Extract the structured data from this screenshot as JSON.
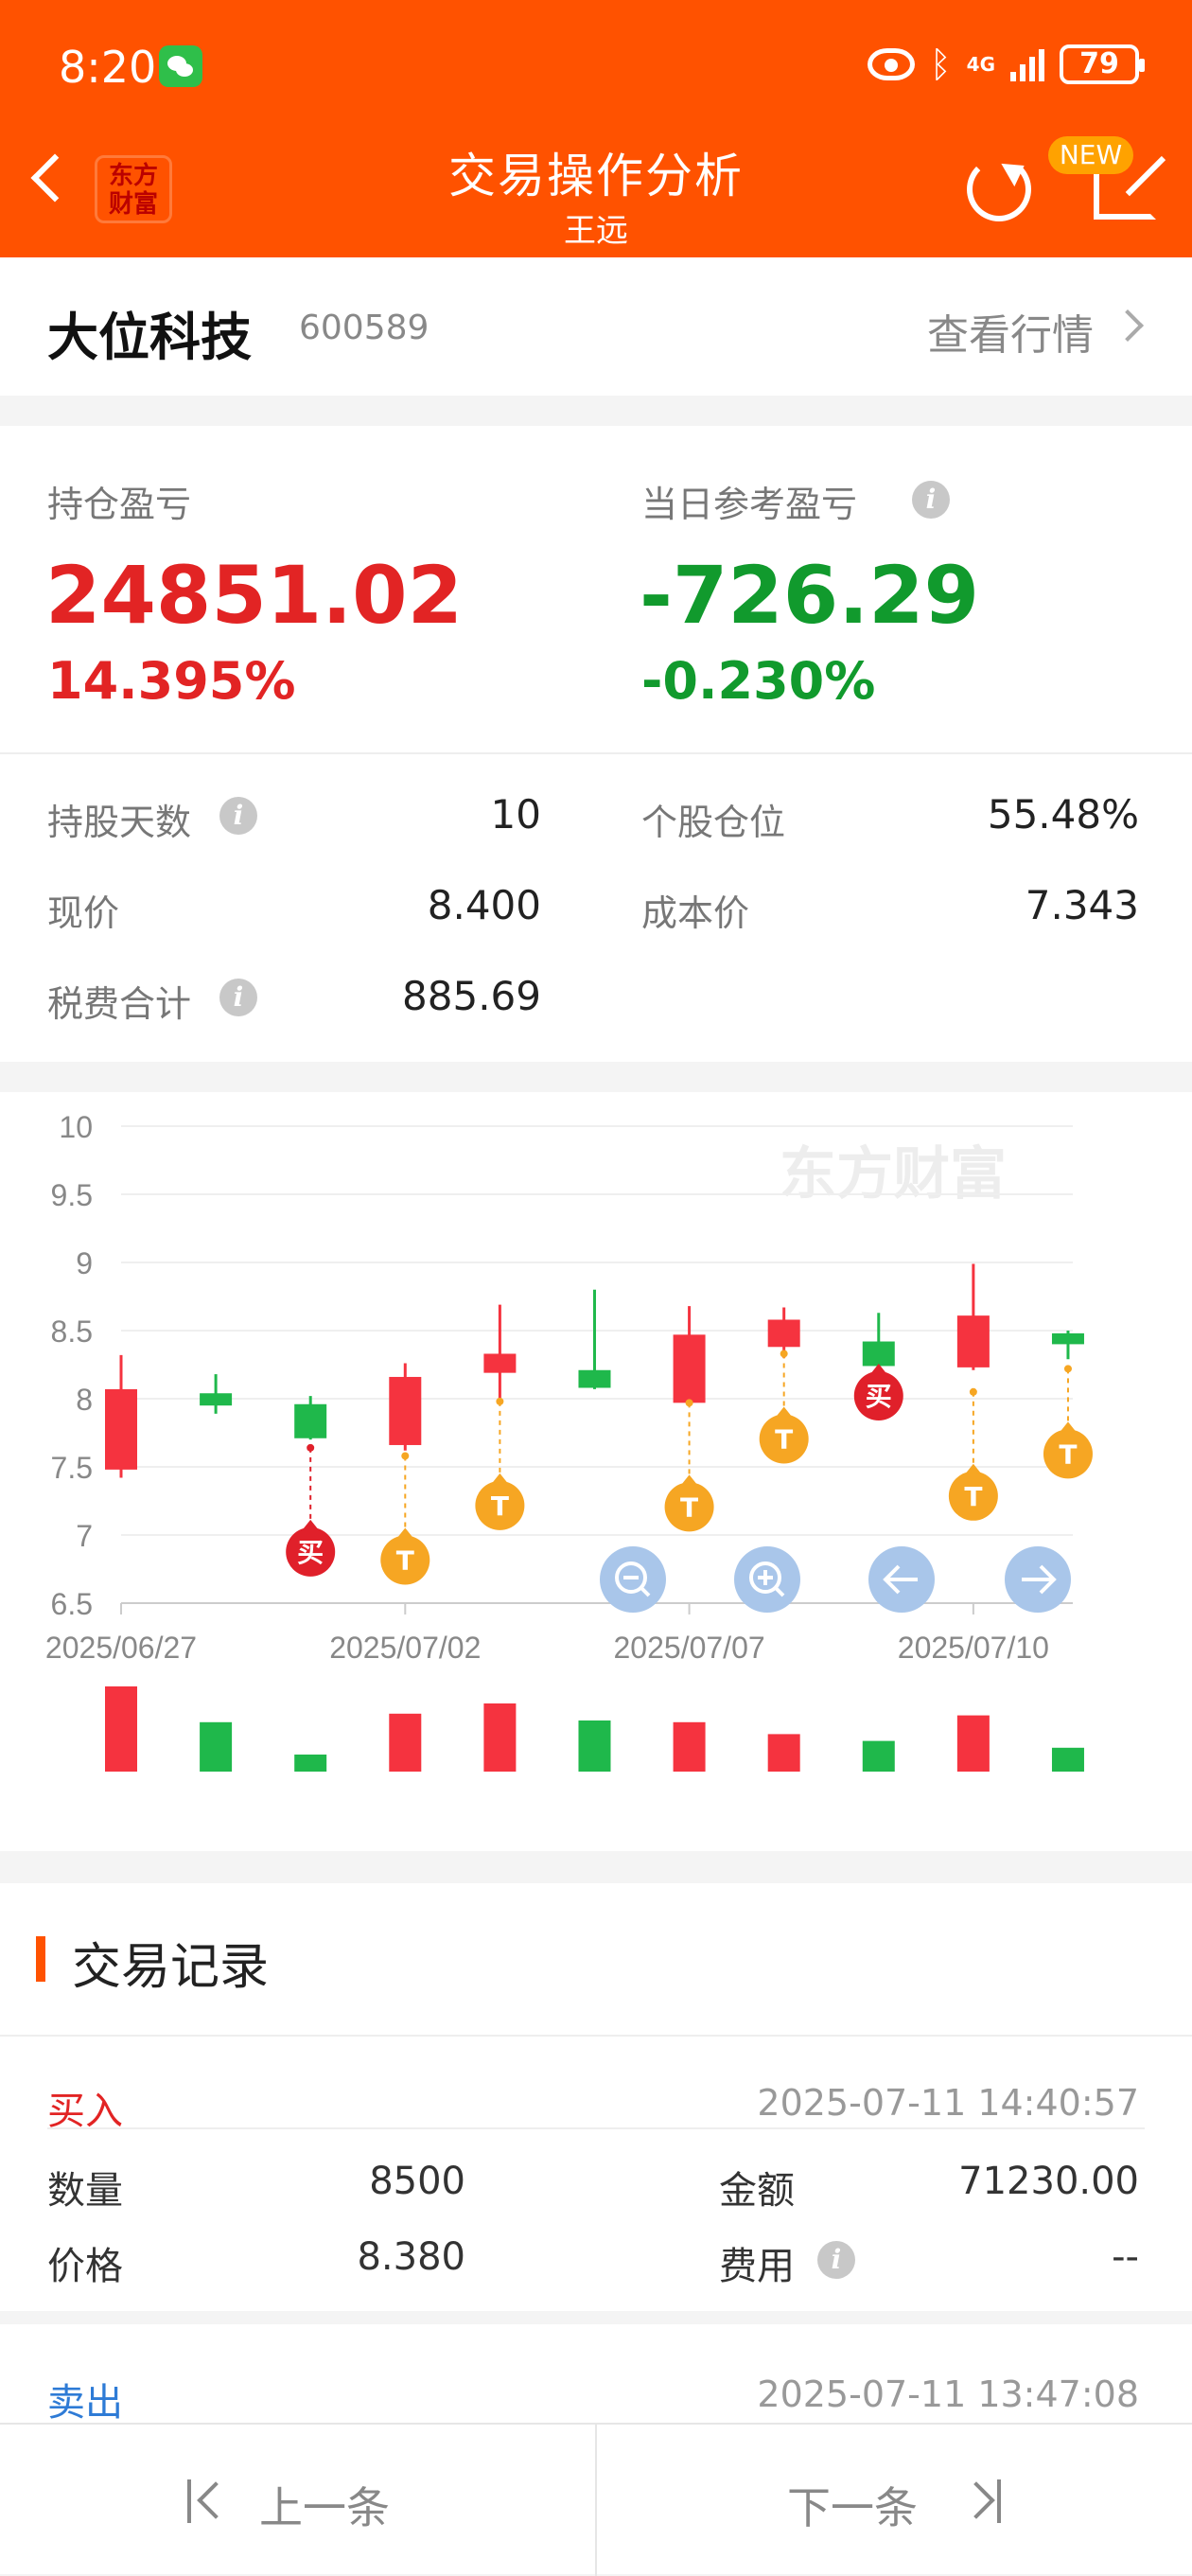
{
  "status": {
    "time": "8:20",
    "network": "4G",
    "battery": "79"
  },
  "header": {
    "title": "交易操作分析",
    "subtitle": "王远",
    "logo_line1": "东方",
    "logo_line2": "财富",
    "new_badge": "NEW"
  },
  "stock": {
    "name": "大位科技",
    "code": "600589",
    "view_quote": "查看行情"
  },
  "profit": {
    "position_label": "持仓盈亏",
    "position_value": "24851.02",
    "position_pct": "14.395%",
    "daily_label": "当日参考盈亏",
    "daily_value": "-726.29",
    "daily_pct": "-0.230%"
  },
  "details": {
    "hold_days_label": "持股天数",
    "hold_days": "10",
    "position_ratio_label": "个股仓位",
    "position_ratio": "55.48%",
    "price_label": "现价",
    "price": "8.400",
    "cost_label": "成本价",
    "cost": "7.343",
    "fee_label": "税费合计",
    "fee": "885.69"
  },
  "watermark": "东方财富",
  "chart_data": {
    "type": "candlestick",
    "title": "",
    "ylim": [
      6.5,
      10
    ],
    "yticks": [
      "10",
      "9.5",
      "9",
      "8.5",
      "8",
      "7.5",
      "7",
      "6.5"
    ],
    "xtick_labels": [
      "2025/06/27",
      "2025/07/02",
      "2025/07/07",
      "2025/07/10"
    ],
    "xtick_index": [
      0,
      3,
      6,
      9
    ],
    "candles": [
      {
        "open": 7.48,
        "close": 8.07,
        "high": 8.32,
        "low": 7.42
      },
      {
        "open": 8.04,
        "close": 7.95,
        "high": 8.18,
        "low": 7.89
      },
      {
        "open": 7.96,
        "close": 7.71,
        "high": 8.02,
        "low": 7.7
      },
      {
        "open": 7.66,
        "close": 8.16,
        "high": 8.26,
        "low": 7.62
      },
      {
        "open": 8.19,
        "close": 8.33,
        "high": 8.69,
        "low": 7.98
      },
      {
        "open": 8.21,
        "close": 8.08,
        "high": 8.8,
        "low": 8.07
      },
      {
        "open": 7.97,
        "close": 8.47,
        "high": 8.68,
        "low": 7.95
      },
      {
        "open": 8.38,
        "close": 8.58,
        "high": 8.67,
        "low": 8.3
      },
      {
        "open": 8.42,
        "close": 8.24,
        "high": 8.63,
        "low": 8.23
      },
      {
        "open": 8.23,
        "close": 8.61,
        "high": 8.99,
        "low": 8.21
      },
      {
        "open": 8.48,
        "close": 8.4,
        "high": 8.5,
        "low": 8.29
      }
    ],
    "volume": [
      1.0,
      0.58,
      0.2,
      0.68,
      0.8,
      0.6,
      0.58,
      0.44,
      0.36,
      0.66,
      0.28
    ],
    "markers": [
      {
        "index": 2,
        "label": "买",
        "kind": "buy",
        "price": 7.64
      },
      {
        "index": 3,
        "label": "T",
        "kind": "t",
        "price": 7.58
      },
      {
        "index": 4,
        "label": "T",
        "kind": "t",
        "price": 7.98
      },
      {
        "index": 6,
        "label": "T",
        "kind": "t",
        "price": 7.97
      },
      {
        "index": 7,
        "label": "T",
        "kind": "t",
        "price": 8.33
      },
      {
        "index": 8,
        "label": "买",
        "kind": "buy",
        "price": 8.16
      },
      {
        "index": 9,
        "label": "T",
        "kind": "t",
        "price": 8.05
      },
      {
        "index": 10,
        "label": "T",
        "kind": "t",
        "price": 8.22
      }
    ],
    "colors": {
      "up": "#f5333f",
      "down": "#1fb84b",
      "buy": "#e0202a",
      "t": "#f6a623",
      "grid": "#efefef"
    }
  },
  "chart_buttons": [
    "zoom-out",
    "zoom-in",
    "left",
    "right"
  ],
  "records": {
    "title": "交易记录",
    "items": [
      {
        "type": "买入",
        "time": "2025-07-11 14:40:57",
        "qty_label": "数量",
        "qty": "8500",
        "amount_label": "金额",
        "amount": "71230.00",
        "price_label": "价格",
        "price": "8.380",
        "fee_label": "费用",
        "fee": "--"
      },
      {
        "type": "卖出",
        "time": "2025-07-11 13:47:08"
      }
    ]
  },
  "nav": {
    "prev": "上一条",
    "next": "下一条"
  }
}
